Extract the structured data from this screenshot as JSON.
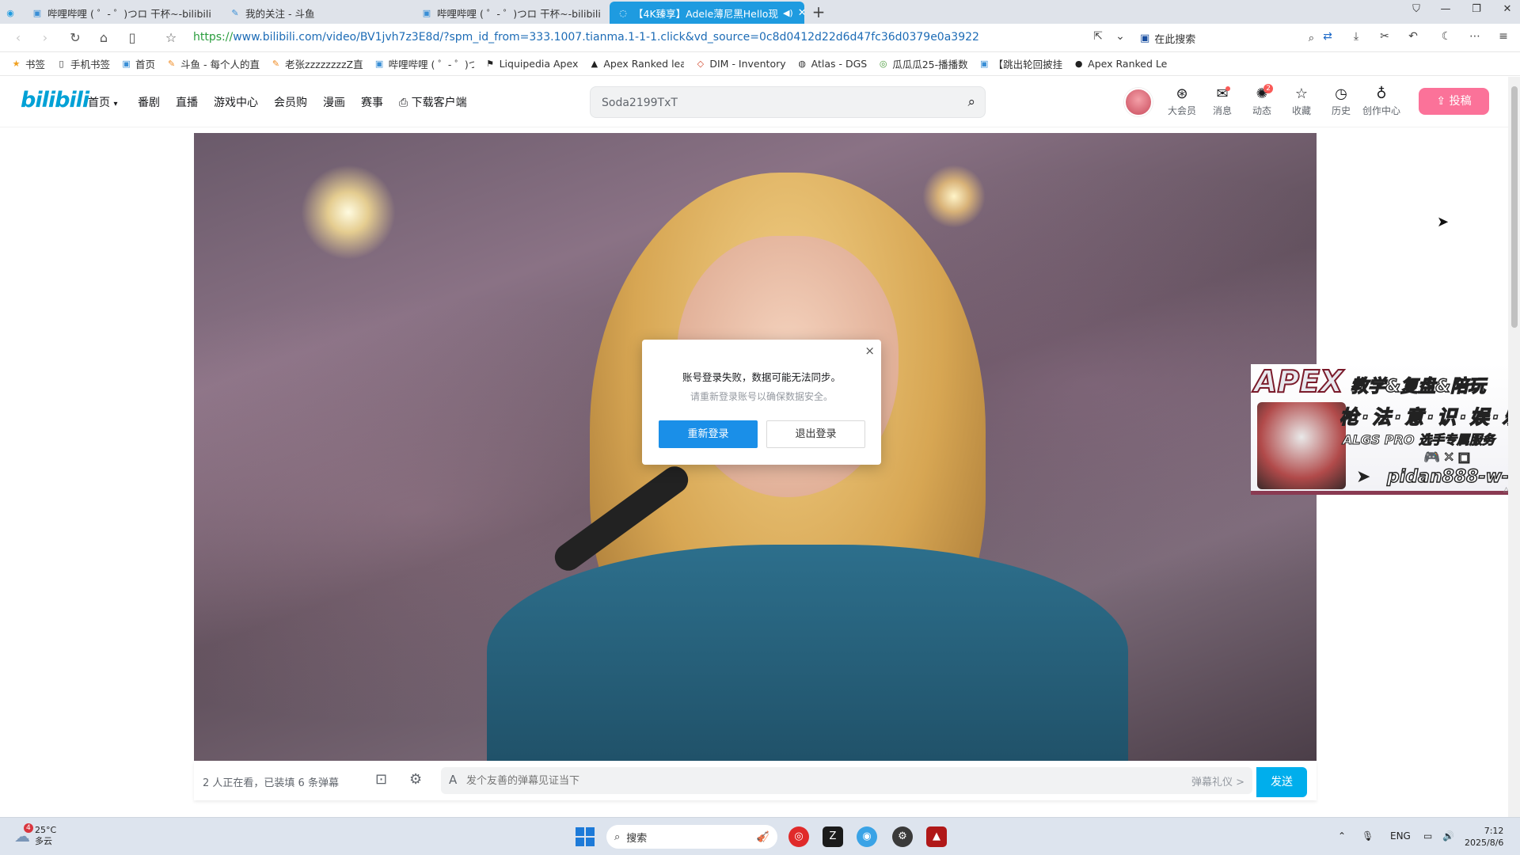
{
  "browser": {
    "tabs": [
      {
        "title": "哔哩哔哩 ( ゜- ゜)つロ 干杯~-bilibili",
        "icon": "bilibili-icon"
      },
      {
        "title": "我的关注 - 斗鱼",
        "icon": "douyu-icon"
      },
      {
        "title": "哔哩哔哩 ( ゜- ゜)つロ 干杯~-bilibili",
        "icon": "bilibili-icon"
      },
      {
        "title": "【4K臻享】Adele薄尼黑Hello现",
        "icon": "bilibili-icon"
      }
    ],
    "url_scheme": "https://",
    "url_rest": "www.bilibili.com/video/BV1jvh7z3E8d/?spm_id_from=333.1007.tianma.1-1-1.click&vd_source=0c8d0412d22d6d47fc36d0379e0a3922",
    "search_label": "在此搜索",
    "bookmarks": [
      {
        "label": "书签",
        "icon": "star-icon"
      },
      {
        "label": "手机书签",
        "icon": "phone-icon"
      },
      {
        "label": "首页",
        "icon": "bilibili-icon"
      },
      {
        "label": "斗鱼 - 每个人的直",
        "icon": "douyu-icon"
      },
      {
        "label": "老张zzzzzzzzZ直",
        "icon": "douyu-icon"
      },
      {
        "label": "哔哩哔哩 ( ゜- ゜)つ",
        "icon": "bilibili-icon"
      },
      {
        "label": "Liquipedia Apex",
        "icon": "liquipedia-icon"
      },
      {
        "label": "Apex Ranked lea",
        "icon": "apex-icon"
      },
      {
        "label": "DIM - Inventory",
        "icon": "dim-icon"
      },
      {
        "label": "Atlas - DGS",
        "icon": "globe-icon"
      },
      {
        "label": "瓜瓜瓜25-播播数",
        "icon": "site-icon"
      },
      {
        "label": "【跳出轮回披挂",
        "icon": "bilibili-icon"
      },
      {
        "label": "Apex Ranked Le",
        "icon": "apex-icon"
      }
    ]
  },
  "bili": {
    "logo": "bilibili",
    "nav": [
      "首页",
      "番剧",
      "直播",
      "游戏中心",
      "会员购",
      "漫画",
      "赛事",
      "下载客户端"
    ],
    "search_value": "Soda2199TxT",
    "header_icons": [
      {
        "label": "大会员",
        "icon": "vip-icon"
      },
      {
        "label": "消息",
        "icon": "message-icon"
      },
      {
        "label": "动态",
        "icon": "dynamic-icon",
        "badge": "2"
      },
      {
        "label": "收藏",
        "icon": "favorite-icon"
      },
      {
        "label": "历史",
        "icon": "history-icon"
      },
      {
        "label": "创作中心",
        "icon": "creator-icon"
      }
    ],
    "upload_label": "投稿"
  },
  "dialog": {
    "title": "账号登录失败，数据可能无法同步。",
    "subtitle": "请重新登录账号以确保数据安全。",
    "relogin": "重新登录",
    "logout": "退出登录",
    "close": "×"
  },
  "ad": {
    "apex": "APEX",
    "line1": "教学&复盘&陪玩",
    "line2": "枪·法·意·识·娱·乐",
    "line3": "ALGS PRO 选手专属服务",
    "handle": "pidan888-w-"
  },
  "danmaku": {
    "info": "2 人正在看，已装填 6 条弹幕",
    "placeholder": "发个友善的弹幕见证当下",
    "etiquette": "弹幕礼仪 >",
    "send": "发送"
  },
  "taskbar": {
    "weather_badge": "4",
    "temp": "25°C",
    "cond": "多云",
    "search": "搜索",
    "lang": "ENG",
    "time": "7:12",
    "date": "2025/8/6"
  }
}
